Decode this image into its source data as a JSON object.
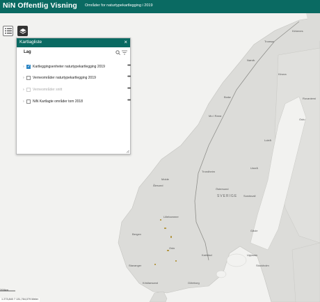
{
  "header": {
    "title": "NiN Offentlig Visning",
    "subtitle": "Områder for naturtypekartlegging i 2019"
  },
  "toolbar": {
    "list_icon": "layer-list-icon",
    "layers_icon": "layers-icon"
  },
  "layer_panel": {
    "title": "Kartlagliste",
    "close_label": "×",
    "section_label": "Lag",
    "items": [
      {
        "label": "Kartleggingsenheter naturtypekartlegging 2019",
        "checked": true,
        "muted": false,
        "more": "•••"
      },
      {
        "label": "Verneområder naturtypekartlegging 2019",
        "checked": false,
        "muted": false,
        "more": "•••"
      },
      {
        "label": "Verneområder snitt",
        "checked": false,
        "muted": true,
        "more": "•••"
      },
      {
        "label": "NiN Kartlagte områder tom 2018",
        "checked": false,
        "muted": false,
        "more": "•••"
      }
    ]
  },
  "map": {
    "country_label": "SVERIGE",
    "places": [
      "Tromsø",
      "Narvik",
      "Bodø",
      "Mo i Rana",
      "Trondheim",
      "Bergen",
      "Oslo",
      "Lillehammer",
      "Stavanger",
      "Kristiansand",
      "Kirkenes",
      "Luleå",
      "Umeå",
      "Östersund",
      "Sundsvall",
      "Gävle",
      "Stockholm",
      "Uppsala",
      "Göteborg",
      "Karlstad",
      "Ålesund",
      "Molde",
      "Kiruna",
      "Rovaniemi",
      "Oulu"
    ],
    "scale_label": "200km",
    "coordinates": "1 273,840 7 131,764,079 Meter"
  },
  "colors": {
    "brand": "#0a6a62",
    "checkbox": "#2a84c4"
  }
}
